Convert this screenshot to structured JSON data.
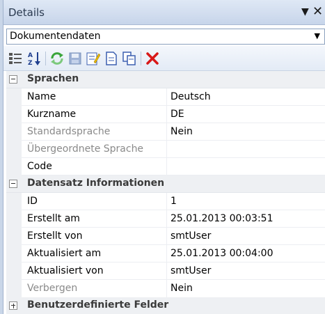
{
  "panel": {
    "title": "Details",
    "pin_icon": "dropdown-triangle-icon",
    "close_icon": "close-icon"
  },
  "selector": {
    "selected": "Dokumentendaten"
  },
  "toolbar": {
    "icons": [
      "categorized-view-icon",
      "sort-az-icon",
      "refresh-icon",
      "save-icon",
      "edit-icon",
      "new-document-icon",
      "copy-icon",
      "delete-icon"
    ]
  },
  "grid": {
    "categories": [
      {
        "label": "Sprachen",
        "expanded": true,
        "rows": [
          {
            "name": "Name",
            "value": "Deutsch",
            "readonly": false
          },
          {
            "name": "Kurzname",
            "value": "DE",
            "readonly": false
          },
          {
            "name": "Standardsprache",
            "value": "Nein",
            "readonly": true
          },
          {
            "name": "Übergeordnete Sprache",
            "value": "",
            "readonly": true
          },
          {
            "name": "Code",
            "value": "",
            "readonly": false
          }
        ]
      },
      {
        "label": "Datensatz Informationen",
        "expanded": true,
        "rows": [
          {
            "name": "ID",
            "value": "1",
            "readonly": false
          },
          {
            "name": "Erstellt am",
            "value": "25.01.2013 00:03:51",
            "readonly": false
          },
          {
            "name": "Erstellt von",
            "value": "smtUser",
            "readonly": false
          },
          {
            "name": "Aktualisiert am",
            "value": "25.01.2013 00:04:00",
            "readonly": false
          },
          {
            "name": "Aktualisiert von",
            "value": "smtUser",
            "readonly": false
          },
          {
            "name": "Verbergen",
            "value": "Nein",
            "readonly": true
          }
        ]
      },
      {
        "label": "Benutzerdefinierte Felder",
        "expanded": false,
        "rows": []
      }
    ]
  },
  "colors": {
    "titlebar": "#c7d5ea",
    "category_bg": "#eef0f3",
    "readonly_text": "#8a8a8a",
    "delete_red": "#d81818",
    "refresh_green": "#3aa53a"
  }
}
